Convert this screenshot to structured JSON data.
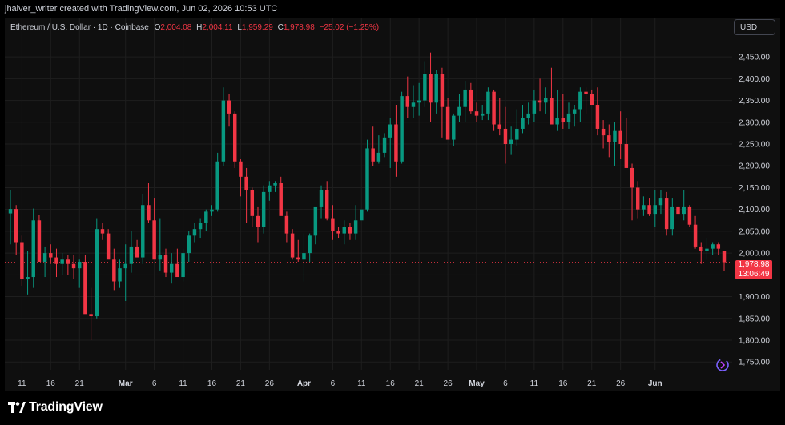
{
  "header": {
    "attribution": "jhalver_writer created with TradingView.com, Jun 02, 2026 10:53 UTC"
  },
  "legend": {
    "symbol": "Ethereum / U.S. Dollar · 1D · Coinbase",
    "o_label": "O",
    "o_value": "2,004.08",
    "h_label": "H",
    "h_value": "2,004.11",
    "l_label": "L",
    "l_value": "1,959.29",
    "c_label": "C",
    "c_value": "1,978.98",
    "change": "−25.02 (−1.25%)"
  },
  "currency_button": "USD",
  "price_tag": {
    "price": "1,978.98",
    "countdown": "13:06:49"
  },
  "footer": {
    "logo_text": "TradingView"
  },
  "colors": {
    "up": "#089981",
    "down": "#f23645",
    "background": "#0f0f0f",
    "grid": "#1e1e1e",
    "text": "#d1d4dc"
  },
  "icons": [
    "sync-icon",
    "tradingview-logo-icon"
  ],
  "chart_data": {
    "type": "candlestick",
    "title": "Ethereum / U.S. Dollar · 1D · Coinbase",
    "ylim": [
      1732,
      2498
    ],
    "y_ticks": [
      "2,450.00",
      "2,400.00",
      "2,350.00",
      "2,300.00",
      "2,250.00",
      "2,200.00",
      "2,150.00",
      "2,100.00",
      "2,050.00",
      "2,000.00",
      "1,950.00",
      "1,900.00",
      "1,850.00",
      "1,800.00",
      "1,750.00"
    ],
    "y_tick_values": [
      2450,
      2400,
      2350,
      2300,
      2250,
      2200,
      2150,
      2100,
      2050,
      2000,
      1950,
      1900,
      1850,
      1800,
      1750
    ],
    "x_ticks": [
      {
        "label": "11",
        "bold": false,
        "index": 2
      },
      {
        "label": "16",
        "bold": false,
        "index": 7
      },
      {
        "label": "21",
        "bold": false,
        "index": 12
      },
      {
        "label": "Mar",
        "bold": true,
        "index": 20
      },
      {
        "label": "6",
        "bold": false,
        "index": 25
      },
      {
        "label": "11",
        "bold": false,
        "index": 30
      },
      {
        "label": "16",
        "bold": false,
        "index": 35
      },
      {
        "label": "21",
        "bold": false,
        "index": 40
      },
      {
        "label": "26",
        "bold": false,
        "index": 45
      },
      {
        "label": "Apr",
        "bold": true,
        "index": 51
      },
      {
        "label": "6",
        "bold": false,
        "index": 56
      },
      {
        "label": "11",
        "bold": false,
        "index": 61
      },
      {
        "label": "16",
        "bold": false,
        "index": 66
      },
      {
        "label": "21",
        "bold": false,
        "index": 71
      },
      {
        "label": "26",
        "bold": false,
        "index": 76
      },
      {
        "label": "May",
        "bold": true,
        "index": 81
      },
      {
        "label": "6",
        "bold": false,
        "index": 86
      },
      {
        "label": "11",
        "bold": false,
        "index": 91
      },
      {
        "label": "16",
        "bold": false,
        "index": 96
      },
      {
        "label": "21",
        "bold": false,
        "index": 101
      },
      {
        "label": "26",
        "bold": false,
        "index": 106
      },
      {
        "label": "Jun",
        "bold": true,
        "index": 112
      }
    ],
    "last_price": 1978.98,
    "candles": [
      [
        2091,
        2145,
        2020,
        2101
      ],
      [
        2101,
        2110,
        1995,
        2025
      ],
      [
        2025,
        2040,
        1925,
        1940
      ],
      [
        1940,
        2005,
        1905,
        1945
      ],
      [
        1945,
        2102,
        1920,
        2075
      ],
      [
        2075,
        2088,
        1990,
        1980
      ],
      [
        1980,
        2015,
        1945,
        2000
      ],
      [
        2000,
        2020,
        1975,
        1990
      ],
      [
        1990,
        2010,
        1945,
        1975
      ],
      [
        1975,
        2000,
        1950,
        1985
      ],
      [
        1985,
        1995,
        1950,
        1975
      ],
      [
        1975,
        1995,
        1940,
        1965
      ],
      [
        1965,
        1985,
        1920,
        1980
      ],
      [
        1980,
        1995,
        1880,
        1860
      ],
      [
        1860,
        1920,
        1800,
        1855
      ],
      [
        1855,
        2080,
        1850,
        2055
      ],
      [
        2055,
        2070,
        2030,
        2045
      ],
      [
        2045,
        2055,
        2005,
        1985
      ],
      [
        1985,
        2010,
        1915,
        1935
      ],
      [
        1935,
        1985,
        1920,
        1965
      ],
      [
        1965,
        2020,
        1890,
        1975
      ],
      [
        1975,
        2050,
        1955,
        2015
      ],
      [
        2015,
        2030,
        1990,
        1990
      ],
      [
        1990,
        2135,
        1975,
        2110
      ],
      [
        2110,
        2160,
        2070,
        2075
      ],
      [
        2075,
        2125,
        2050,
        1985
      ],
      [
        1985,
        2080,
        1960,
        1995
      ],
      [
        1995,
        2010,
        1945,
        1955
      ],
      [
        1955,
        2000,
        1930,
        1975
      ],
      [
        1975,
        2010,
        1955,
        1945
      ],
      [
        1945,
        2010,
        1935,
        2000
      ],
      [
        2000,
        2050,
        1980,
        2040
      ],
      [
        2040,
        2070,
        2025,
        2055
      ],
      [
        2055,
        2080,
        2035,
        2070
      ],
      [
        2070,
        2100,
        2050,
        2095
      ],
      [
        2095,
        2110,
        2085,
        2100
      ],
      [
        2100,
        2230,
        2095,
        2210
      ],
      [
        2210,
        2380,
        2200,
        2350
      ],
      [
        2350,
        2365,
        2290,
        2320
      ],
      [
        2320,
        2325,
        2195,
        2210
      ],
      [
        2210,
        2215,
        2130,
        2175
      ],
      [
        2175,
        2195,
        2070,
        2145
      ],
      [
        2145,
        2150,
        2060,
        2085
      ],
      [
        2085,
        2105,
        2025,
        2060
      ],
      [
        2060,
        2155,
        2045,
        2140
      ],
      [
        2140,
        2165,
        2120,
        2155
      ],
      [
        2155,
        2165,
        2140,
        2160
      ],
      [
        2160,
        2175,
        2130,
        2085
      ],
      [
        2085,
        2095,
        2025,
        2045
      ],
      [
        2045,
        2055,
        1985,
        1990
      ],
      [
        1990,
        2030,
        1980,
        1985
      ],
      [
        1985,
        2045,
        1935,
        2000
      ],
      [
        2000,
        2045,
        1980,
        2040
      ],
      [
        2040,
        2095,
        2020,
        2105
      ],
      [
        2105,
        2155,
        2080,
        2145
      ],
      [
        2145,
        2165,
        2075,
        2080
      ],
      [
        2080,
        2110,
        2030,
        2050
      ],
      [
        2050,
        2060,
        2035,
        2045
      ],
      [
        2045,
        2075,
        2020,
        2060
      ],
      [
        2060,
        2070,
        2030,
        2045
      ],
      [
        2045,
        2110,
        2030,
        2075
      ],
      [
        2075,
        2090,
        2095,
        2100
      ],
      [
        2100,
        2260,
        2095,
        2240
      ],
      [
        2240,
        2290,
        2200,
        2210
      ],
      [
        2210,
        2270,
        2205,
        2230
      ],
      [
        2230,
        2275,
        2220,
        2265
      ],
      [
        2265,
        2310,
        2195,
        2295
      ],
      [
        2295,
        2340,
        2175,
        2210
      ],
      [
        2210,
        2370,
        2205,
        2360
      ],
      [
        2360,
        2405,
        2310,
        2335
      ],
      [
        2335,
        2385,
        2310,
        2345
      ],
      [
        2345,
        2390,
        2315,
        2350
      ],
      [
        2350,
        2440,
        2335,
        2410
      ],
      [
        2410,
        2460,
        2300,
        2345
      ],
      [
        2345,
        2420,
        2320,
        2410
      ],
      [
        2410,
        2425,
        2265,
        2335
      ],
      [
        2335,
        2355,
        2265,
        2260
      ],
      [
        2260,
        2320,
        2245,
        2315
      ],
      [
        2315,
        2365,
        2300,
        2335
      ],
      [
        2335,
        2395,
        2300,
        2375
      ],
      [
        2375,
        2390,
        2320,
        2325
      ],
      [
        2325,
        2345,
        2300,
        2315
      ],
      [
        2315,
        2340,
        2305,
        2320
      ],
      [
        2320,
        2380,
        2305,
        2370
      ],
      [
        2370,
        2375,
        2280,
        2295
      ],
      [
        2295,
        2355,
        2270,
        2285
      ],
      [
        2285,
        2335,
        2205,
        2250
      ],
      [
        2250,
        2290,
        2225,
        2260
      ],
      [
        2260,
        2330,
        2245,
        2285
      ],
      [
        2285,
        2340,
        2275,
        2310
      ],
      [
        2310,
        2345,
        2295,
        2320
      ],
      [
        2320,
        2375,
        2300,
        2350
      ],
      [
        2350,
        2400,
        2325,
        2345
      ],
      [
        2345,
        2380,
        2320,
        2355
      ],
      [
        2355,
        2425,
        2305,
        2295
      ],
      [
        2295,
        2375,
        2280,
        2310
      ],
      [
        2310,
        2365,
        2285,
        2300
      ],
      [
        2300,
        2345,
        2285,
        2320
      ],
      [
        2320,
        2340,
        2290,
        2330
      ],
      [
        2330,
        2380,
        2300,
        2370
      ],
      [
        2370,
        2380,
        2320,
        2365
      ],
      [
        2365,
        2375,
        2340,
        2340
      ],
      [
        2340,
        2380,
        2270,
        2285
      ],
      [
        2285,
        2305,
        2240,
        2270
      ],
      [
        2270,
        2295,
        2220,
        2255
      ],
      [
        2255,
        2300,
        2200,
        2280
      ],
      [
        2280,
        2325,
        2215,
        2250
      ],
      [
        2250,
        2310,
        2195,
        2195
      ],
      [
        2195,
        2205,
        2075,
        2150
      ],
      [
        2150,
        2165,
        2080,
        2100
      ],
      [
        2100,
        2130,
        2085,
        2110
      ],
      [
        2110,
        2125,
        2085,
        2090
      ],
      [
        2090,
        2145,
        2060,
        2110
      ],
      [
        2110,
        2145,
        2090,
        2125
      ],
      [
        2125,
        2140,
        2040,
        2055
      ],
      [
        2055,
        2125,
        2040,
        2105
      ],
      [
        2105,
        2110,
        2075,
        2090
      ],
      [
        2090,
        2145,
        2075,
        2105
      ],
      [
        2105,
        2110,
        2060,
        2065
      ],
      [
        2065,
        2085,
        2010,
        2015
      ],
      [
        2015,
        2025,
        1975,
        2005
      ],
      [
        2005,
        2035,
        1985,
        2010
      ],
      [
        2010,
        2025,
        1995,
        2020
      ],
      [
        2020,
        2025,
        1995,
        2010
      ],
      [
        2004.08,
        2004.11,
        1959.29,
        1978.98
      ]
    ]
  }
}
